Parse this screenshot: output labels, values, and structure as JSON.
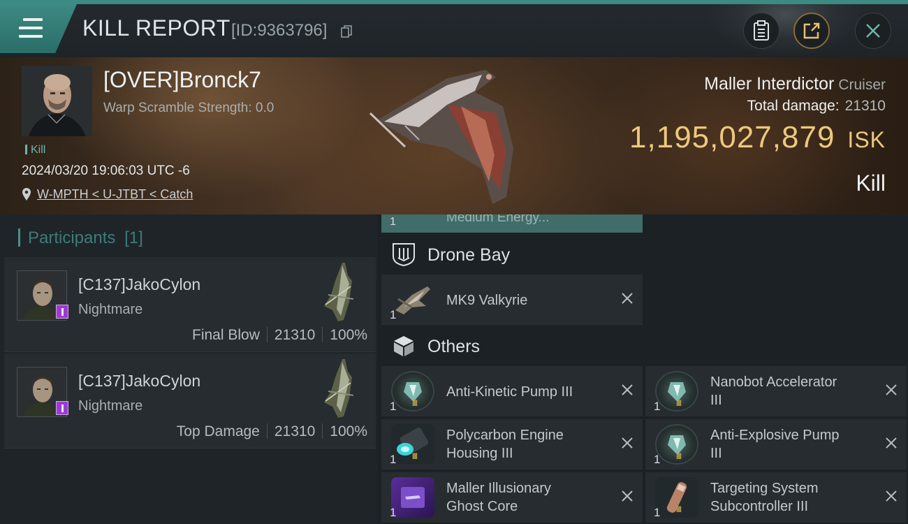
{
  "header": {
    "title": "KILL REPORT",
    "report_id": "[ID:9363796]"
  },
  "victim": {
    "name": "[OVER]Bronck7",
    "warp_scramble": "Warp Scramble Strength: 0.0",
    "kill_tag": "Kill",
    "datetime": "2024/03/20 19:06:03 UTC -6",
    "location": "W-MPTH < U-JTBT < Catch",
    "ship_name": "Maller Interdictor",
    "ship_class": "Cruiser",
    "total_damage_label": "Total damage:",
    "total_damage": "21310",
    "isk_value": "1,195,027,879",
    "isk_unit": "ISK",
    "result": "Kill"
  },
  "participants": {
    "title": "Participants",
    "count": "[1]",
    "list": [
      {
        "name": "[C137]JakoCylon",
        "ship": "Nightmare",
        "role": "Final Blow",
        "damage": "21310",
        "percent": "100%"
      },
      {
        "name": "[C137]JakoCylon",
        "ship": "Nightmare",
        "role": "Top Damage",
        "damage": "21310",
        "percent": "100%"
      }
    ]
  },
  "items": {
    "prev_item": {
      "qty": "1",
      "label": "Medium Energy..."
    },
    "drone_bay": {
      "title": "Drone Bay",
      "entries": [
        {
          "qty": "1",
          "label": "MK9  Valkyrie"
        }
      ]
    },
    "others": {
      "title": "Others",
      "entries": [
        {
          "qty": "1",
          "label1": "Anti-Kinetic Pump III",
          "label2": ""
        },
        {
          "qty": "1",
          "label1": "Nanobot Accelerator",
          "label2": "III"
        },
        {
          "qty": "1",
          "label1": "Polycarbon Engine",
          "label2": "Housing III"
        },
        {
          "qty": "1",
          "label1": "Anti-Explosive Pump",
          "label2": "III"
        },
        {
          "qty": "1",
          "label1": "Maller Illusionary",
          "label2": "Ghost Core"
        },
        {
          "qty": "1",
          "label1": "Targeting System",
          "label2": "Subcontroller III"
        }
      ]
    }
  },
  "colors": {
    "accent": "#3b8a84",
    "isk_gold": "#ecc97c",
    "badge_purple": "#9b3cd1"
  },
  "icons": [
    "menu-icon",
    "copy-icon",
    "clipboard-icon",
    "share-icon",
    "close-icon",
    "location-pin-icon",
    "drone-bay-icon",
    "cube-icon",
    "remove-icon"
  ]
}
